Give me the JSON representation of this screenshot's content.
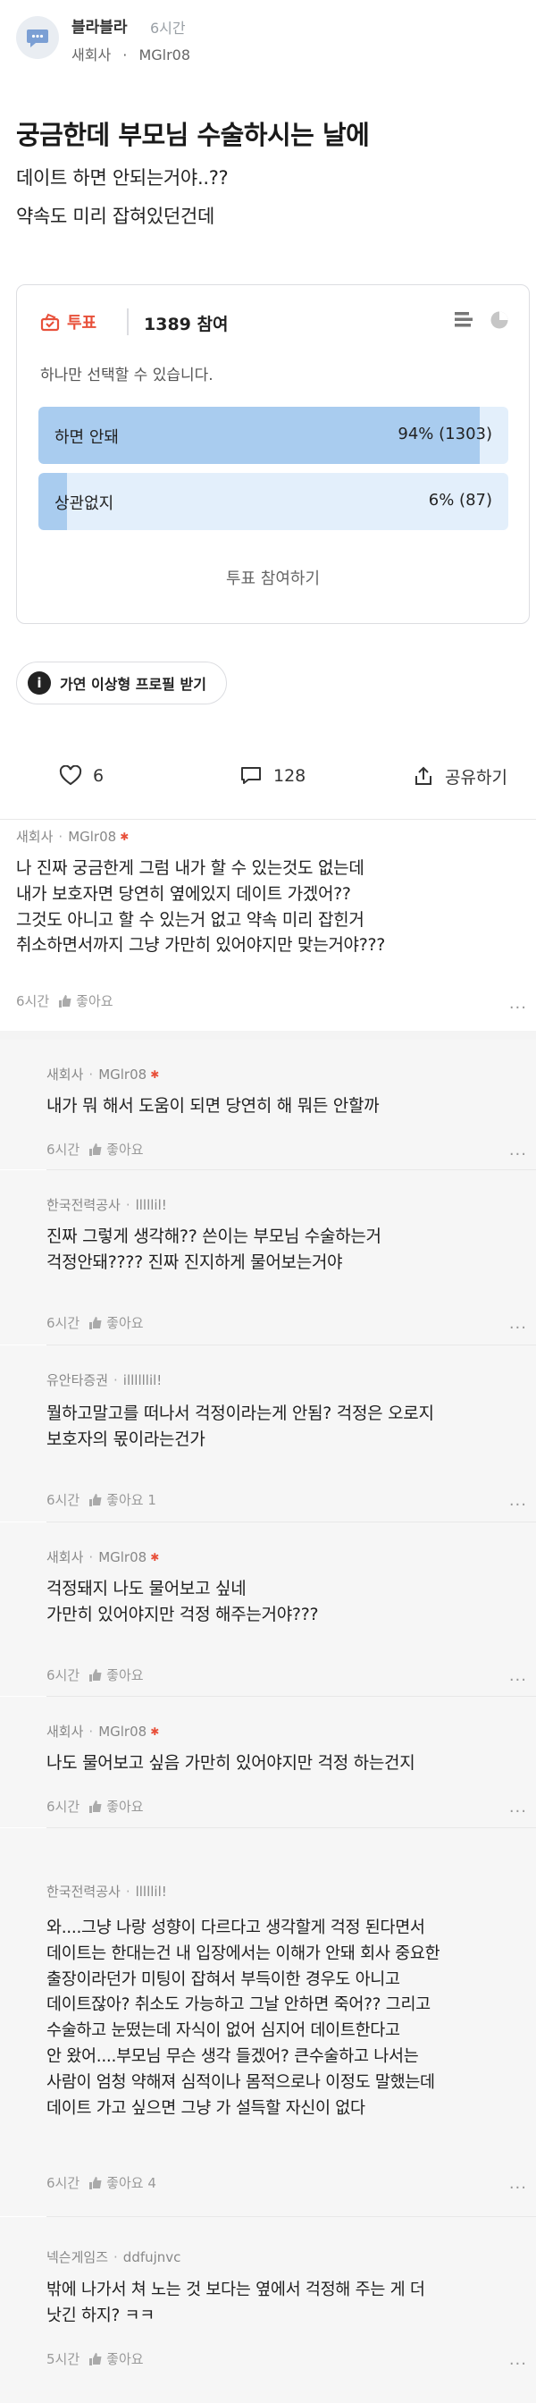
{
  "post": {
    "author": "블라블라",
    "time": "6시간",
    "company": "새회사",
    "separator": "·",
    "user": "MGlr08",
    "title": "궁금한데 부모님 수술하시는 날에",
    "body": [
      "데이트 하면 안되는거야..??",
      "약속도 미리 잡혀있던건데"
    ]
  },
  "poll": {
    "badge": "투표",
    "count": "1389 참여",
    "description": "하나만 선택할 수 있습니다.",
    "options": [
      {
        "label": "하면 안돼",
        "value": "94% (1303)",
        "percent": 94
      },
      {
        "label": "상관없지",
        "value": "6% (87)",
        "percent": 6
      }
    ],
    "join_label": "투표 참여하기",
    "accent": "#e8503a",
    "bar_fill": "#a9ccef",
    "bar_bg": "#e3effb"
  },
  "profile_button": {
    "icon": "i",
    "label": "가연 이상형 프로필 받기"
  },
  "actions": {
    "likes": "6",
    "comments": "128",
    "share": "공유하기"
  },
  "comments": [
    {
      "company": "새회사",
      "user": "MGlr08",
      "is_author": true,
      "lines": [
        "나 진짜 궁금한게 그럼 내가 할 수 있는것도 없는데",
        "내가 보호자면 당연히 옆에있지 데이트 가겠어??",
        "그것도 아니고 할 수 있는거 없고 약속 미리 잡힌거",
        "취소하면서까지 그냥 가만히 있어야지만 맞는거야???"
      ],
      "time": "6시간",
      "like": "좋아요",
      "more": "···"
    },
    {
      "company": "새회사",
      "user": "MGlr08",
      "is_author": true,
      "lines": [
        "내가 뭐 해서 도움이 되면 당연히 해 뭐든 안할까"
      ],
      "time": "6시간",
      "like": "좋아요",
      "more": "···"
    },
    {
      "company": "한국전력공사",
      "user": "lllllil!",
      "is_author": false,
      "lines": [
        "진짜 그렇게 생각해?? 쓴이는 부모님 수술하는거",
        "걱정안돼???? 진짜 진지하게 물어보는거야"
      ],
      "time": "6시간",
      "like": "좋아요",
      "more": "···"
    },
    {
      "company": "유안타증권",
      "user": "illllllil!",
      "is_author": false,
      "lines": [
        "뭘하고말고를 떠나서 걱정이라는게 안됨? 걱정은 오로지",
        "보호자의 몫이라는건가"
      ],
      "time": "6시간",
      "like": "좋아요 1",
      "more": "···"
    },
    {
      "company": "새회사",
      "user": "MGlr08",
      "is_author": true,
      "lines": [
        "걱정돼지 나도 물어보고 싶네",
        "가만히 있어야지만 걱정 해주는거야???"
      ],
      "time": "6시간",
      "like": "좋아요",
      "more": "···"
    },
    {
      "company": "새회사",
      "user": "MGlr08",
      "is_author": true,
      "lines": [
        "나도 물어보고 싶음 가만히 있어야지만 걱정 하는건지"
      ],
      "time": "6시간",
      "like": "좋아요",
      "more": "···"
    },
    {
      "company": "한국전력공사",
      "user": "lllllil!",
      "is_author": false,
      "lines": [
        "와....그냥 나랑 성향이 다르다고 생각할게 걱정 된다면서",
        "데이트는 한대는건 내 입장에서는 이해가 안돼 회사 중요한",
        "출장이라던가 미팅이 잡혀서 부득이한 경우도 아니고",
        "데이트잖아? 취소도 가능하고 그날 안하면 죽어?? 그리고",
        "수술하고 눈떴는데 자식이 없어 심지어 데이트한다고",
        "안 왔어....부모님 무슨 생각 들겠어? 큰수술하고 나서는",
        "사람이 엄청 약해져 심적이나 몸적으로나 이정도 말했는데",
        "데이트 가고 싶으면 그냥 가 설득할 자신이 없다"
      ],
      "time": "6시간",
      "like": "좋아요 4",
      "more": "···"
    },
    {
      "company": "넥슨게임즈",
      "user": "ddfujnvc",
      "is_author": false,
      "lines": [
        "밖에 나가서 쳐 노는 것 보다는 옆에서 걱정해 주는 게 더",
        "낫긴 하지? ㅋㅋ"
      ],
      "time": "5시간",
      "like": "좋아요",
      "more": "···"
    }
  ]
}
